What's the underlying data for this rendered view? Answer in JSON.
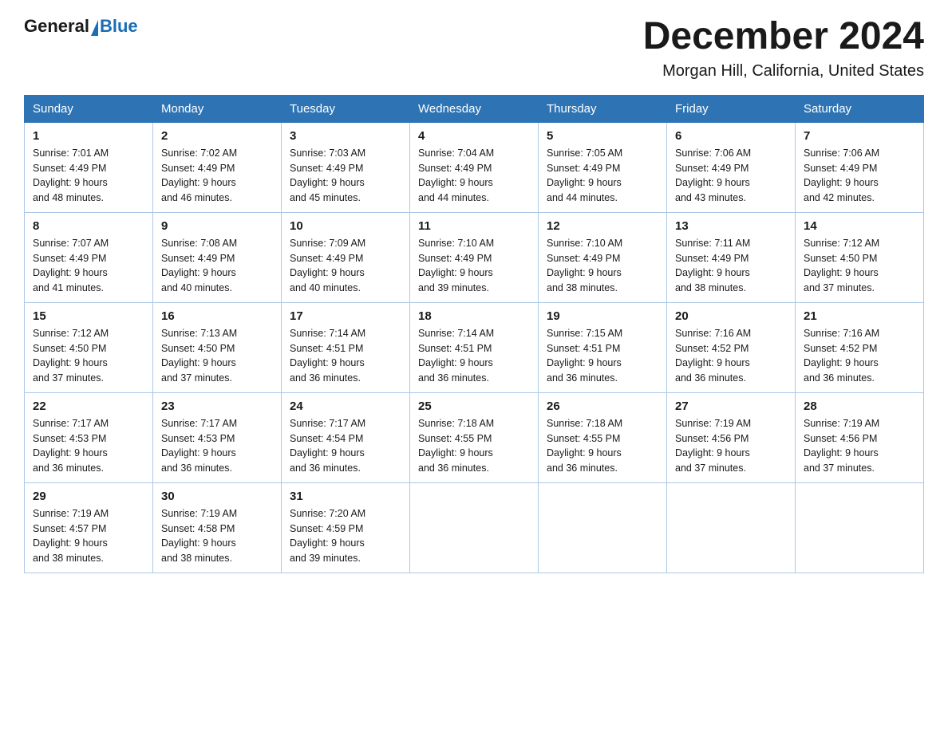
{
  "logo": {
    "general": "General",
    "blue": "Blue"
  },
  "header": {
    "title": "December 2024",
    "subtitle": "Morgan Hill, California, United States"
  },
  "weekdays": [
    "Sunday",
    "Monday",
    "Tuesday",
    "Wednesday",
    "Thursday",
    "Friday",
    "Saturday"
  ],
  "weeks": [
    [
      {
        "day": "1",
        "sunrise": "7:01 AM",
        "sunset": "4:49 PM",
        "daylight": "9 hours and 48 minutes."
      },
      {
        "day": "2",
        "sunrise": "7:02 AM",
        "sunset": "4:49 PM",
        "daylight": "9 hours and 46 minutes."
      },
      {
        "day": "3",
        "sunrise": "7:03 AM",
        "sunset": "4:49 PM",
        "daylight": "9 hours and 45 minutes."
      },
      {
        "day": "4",
        "sunrise": "7:04 AM",
        "sunset": "4:49 PM",
        "daylight": "9 hours and 44 minutes."
      },
      {
        "day": "5",
        "sunrise": "7:05 AM",
        "sunset": "4:49 PM",
        "daylight": "9 hours and 44 minutes."
      },
      {
        "day": "6",
        "sunrise": "7:06 AM",
        "sunset": "4:49 PM",
        "daylight": "9 hours and 43 minutes."
      },
      {
        "day": "7",
        "sunrise": "7:06 AM",
        "sunset": "4:49 PM",
        "daylight": "9 hours and 42 minutes."
      }
    ],
    [
      {
        "day": "8",
        "sunrise": "7:07 AM",
        "sunset": "4:49 PM",
        "daylight": "9 hours and 41 minutes."
      },
      {
        "day": "9",
        "sunrise": "7:08 AM",
        "sunset": "4:49 PM",
        "daylight": "9 hours and 40 minutes."
      },
      {
        "day": "10",
        "sunrise": "7:09 AM",
        "sunset": "4:49 PM",
        "daylight": "9 hours and 40 minutes."
      },
      {
        "day": "11",
        "sunrise": "7:10 AM",
        "sunset": "4:49 PM",
        "daylight": "9 hours and 39 minutes."
      },
      {
        "day": "12",
        "sunrise": "7:10 AM",
        "sunset": "4:49 PM",
        "daylight": "9 hours and 38 minutes."
      },
      {
        "day": "13",
        "sunrise": "7:11 AM",
        "sunset": "4:49 PM",
        "daylight": "9 hours and 38 minutes."
      },
      {
        "day": "14",
        "sunrise": "7:12 AM",
        "sunset": "4:50 PM",
        "daylight": "9 hours and 37 minutes."
      }
    ],
    [
      {
        "day": "15",
        "sunrise": "7:12 AM",
        "sunset": "4:50 PM",
        "daylight": "9 hours and 37 minutes."
      },
      {
        "day": "16",
        "sunrise": "7:13 AM",
        "sunset": "4:50 PM",
        "daylight": "9 hours and 37 minutes."
      },
      {
        "day": "17",
        "sunrise": "7:14 AM",
        "sunset": "4:51 PM",
        "daylight": "9 hours and 36 minutes."
      },
      {
        "day": "18",
        "sunrise": "7:14 AM",
        "sunset": "4:51 PM",
        "daylight": "9 hours and 36 minutes."
      },
      {
        "day": "19",
        "sunrise": "7:15 AM",
        "sunset": "4:51 PM",
        "daylight": "9 hours and 36 minutes."
      },
      {
        "day": "20",
        "sunrise": "7:16 AM",
        "sunset": "4:52 PM",
        "daylight": "9 hours and 36 minutes."
      },
      {
        "day": "21",
        "sunrise": "7:16 AM",
        "sunset": "4:52 PM",
        "daylight": "9 hours and 36 minutes."
      }
    ],
    [
      {
        "day": "22",
        "sunrise": "7:17 AM",
        "sunset": "4:53 PM",
        "daylight": "9 hours and 36 minutes."
      },
      {
        "day": "23",
        "sunrise": "7:17 AM",
        "sunset": "4:53 PM",
        "daylight": "9 hours and 36 minutes."
      },
      {
        "day": "24",
        "sunrise": "7:17 AM",
        "sunset": "4:54 PM",
        "daylight": "9 hours and 36 minutes."
      },
      {
        "day": "25",
        "sunrise": "7:18 AM",
        "sunset": "4:55 PM",
        "daylight": "9 hours and 36 minutes."
      },
      {
        "day": "26",
        "sunrise": "7:18 AM",
        "sunset": "4:55 PM",
        "daylight": "9 hours and 36 minutes."
      },
      {
        "day": "27",
        "sunrise": "7:19 AM",
        "sunset": "4:56 PM",
        "daylight": "9 hours and 37 minutes."
      },
      {
        "day": "28",
        "sunrise": "7:19 AM",
        "sunset": "4:56 PM",
        "daylight": "9 hours and 37 minutes."
      }
    ],
    [
      {
        "day": "29",
        "sunrise": "7:19 AM",
        "sunset": "4:57 PM",
        "daylight": "9 hours and 38 minutes."
      },
      {
        "day": "30",
        "sunrise": "7:19 AM",
        "sunset": "4:58 PM",
        "daylight": "9 hours and 38 minutes."
      },
      {
        "day": "31",
        "sunrise": "7:20 AM",
        "sunset": "4:59 PM",
        "daylight": "9 hours and 39 minutes."
      },
      null,
      null,
      null,
      null
    ]
  ],
  "labels": {
    "sunrise": "Sunrise:",
    "sunset": "Sunset:",
    "daylight": "Daylight:"
  }
}
